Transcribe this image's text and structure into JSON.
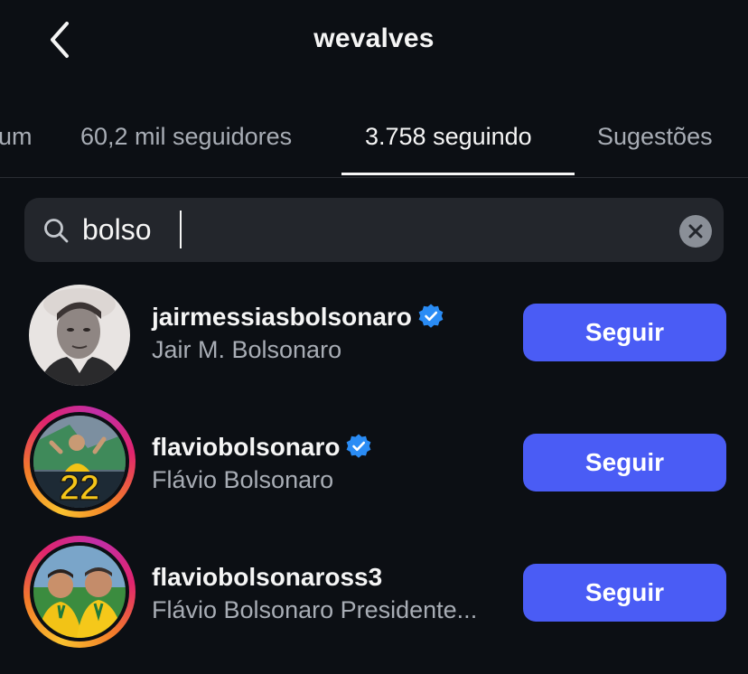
{
  "header": {
    "title": "wevalves",
    "back_icon": "chevron-left-icon"
  },
  "tabs": [
    {
      "label": "um",
      "active": false
    },
    {
      "label": "60,2 mil seguidores",
      "active": false
    },
    {
      "label": "3.758 seguindo",
      "active": true
    },
    {
      "label": "Sugestões",
      "active": false
    }
  ],
  "search": {
    "value": "bolso",
    "icon": "search-icon",
    "clear_icon": "clear-icon"
  },
  "users": [
    {
      "username": "jairmessiasbolsonaro",
      "verified": true,
      "full_name": "Jair M. Bolsonaro",
      "follow_label": "Seguir",
      "story_ring": false
    },
    {
      "username": "flaviobolsonaro",
      "verified": true,
      "full_name": "Flávio Bolsonaro",
      "follow_label": "Seguir",
      "story_ring": true,
      "avatar_text": "22"
    },
    {
      "username": "flaviobolsonaross3",
      "verified": false,
      "full_name": "Flávio Bolsonaro Presidente...",
      "follow_label": "Seguir",
      "story_ring": true
    }
  ],
  "colors": {
    "background": "#0c0f14",
    "button": "#4a5cf5",
    "verified": "#2a8cf5",
    "secondary_text": "#a8adb5"
  }
}
